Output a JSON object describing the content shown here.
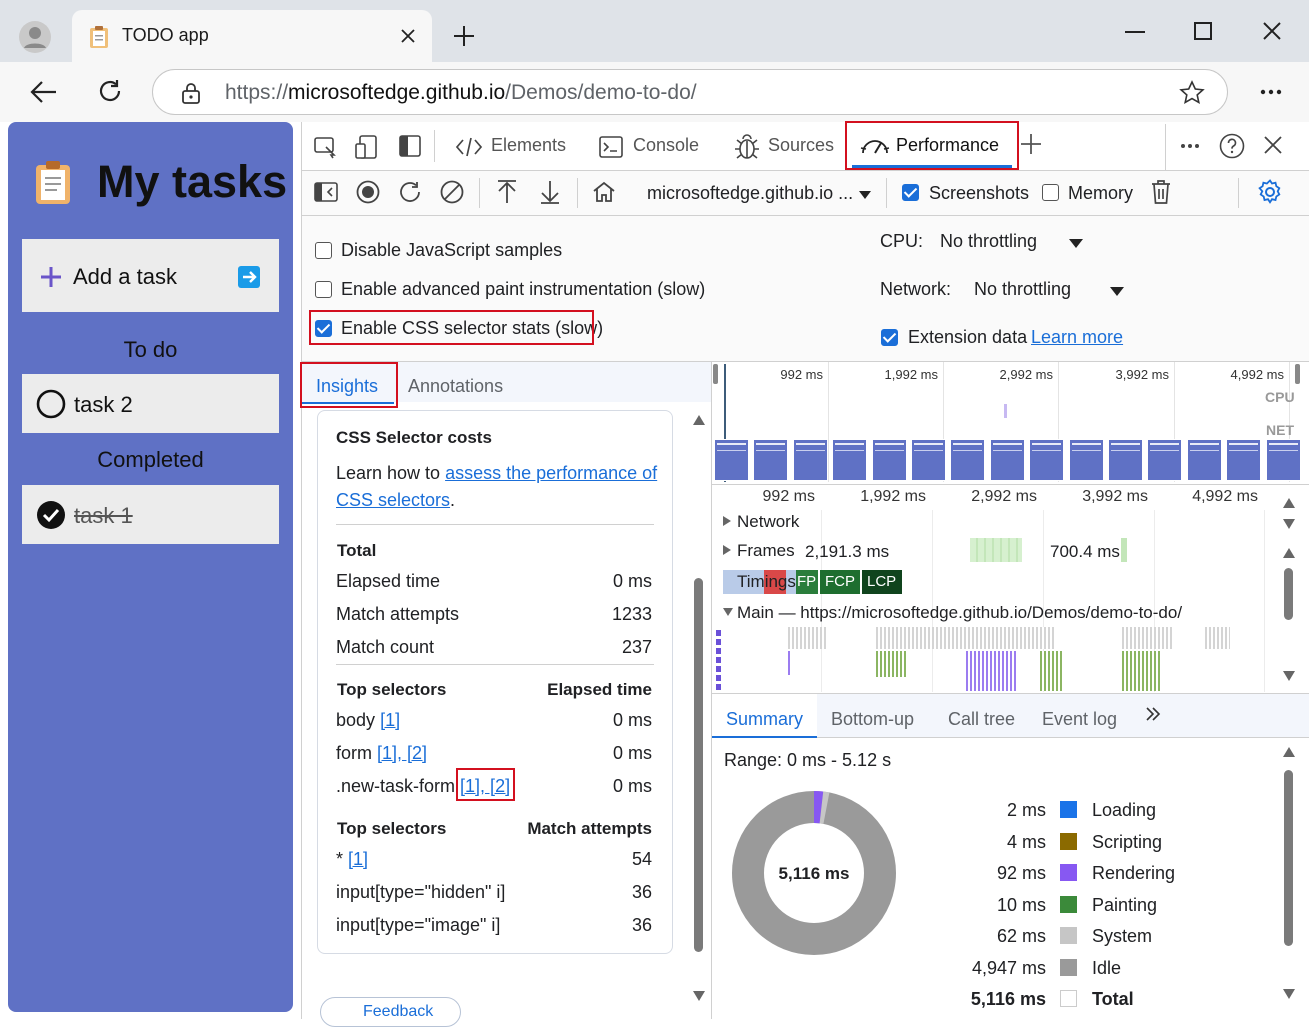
{
  "browser": {
    "tab_title": "TODO app",
    "url_scheme": "https://",
    "url_host": "microsoftedge.github.io",
    "url_path": "/Demos/demo-to-do/"
  },
  "app": {
    "title": "My tasks",
    "add_task_label": "Add a task",
    "todo_heading": "To do",
    "todo_items": [
      "task 2"
    ],
    "completed_heading": "Completed",
    "completed_items": [
      "task 1"
    ]
  },
  "devtools": {
    "tabs": [
      "Elements",
      "Console",
      "Sources",
      "Performance"
    ],
    "active_tab": "Performance",
    "target_select": "microsoftedge.github.io ...",
    "screenshots_label": "Screenshots",
    "memory_label": "Memory",
    "settings": {
      "disable_js_samples": "Disable JavaScript samples",
      "advanced_paint": "Enable advanced paint instrumentation (slow)",
      "css_selector_stats": "Enable CSS selector stats (slow)",
      "cpu_label": "CPU:",
      "cpu_value": "No throttling",
      "network_label": "Network:",
      "network_value": "No throttling",
      "extension_data": "Extension data",
      "learn_more": "Learn more"
    },
    "sidebar_tabs": [
      "Insights",
      "Annotations"
    ],
    "insight": {
      "title": "CSS Selector costs",
      "desc_prefix": "Learn how to ",
      "desc_link1": "assess the performance of",
      "desc_link2": "CSS selectors",
      "desc_suffix": ".",
      "total_heading": "Total",
      "stats": [
        {
          "label": "Elapsed time",
          "value": "0 ms"
        },
        {
          "label": "Match attempts",
          "value": "1233"
        },
        {
          "label": "Match count",
          "value": "237"
        }
      ],
      "top_selectors_heading": "Top selectors",
      "elapsed_heading": "Elapsed time",
      "elapsed_rows": [
        {
          "selector": "body",
          "refs": "[1]",
          "value": "0 ms"
        },
        {
          "selector": "form",
          "refs": "[1], [2]",
          "value": "0 ms"
        },
        {
          "selector": ".new-task-form",
          "refs": "[1], [2]",
          "value": "0 ms"
        }
      ],
      "match_heading": "Match attempts",
      "match_rows": [
        {
          "selector": "*",
          "refs": "[1]",
          "value": "54"
        },
        {
          "selector": "input[type=\"hidden\" i]",
          "refs": "",
          "value": "36"
        },
        {
          "selector": "input[type=\"image\" i]",
          "refs": "",
          "value": "36"
        }
      ],
      "feedback": "Feedback"
    },
    "overview_ticks": [
      "992 ms",
      "1,992 ms",
      "2,992 ms",
      "3,992 ms",
      "4,992 ms"
    ],
    "overview_labels": [
      "CPU",
      "NET"
    ],
    "timeline_ticks": [
      "992 ms",
      "1,992 ms",
      "2,992 ms",
      "3,992 ms",
      "4,992 ms"
    ],
    "tracks": {
      "network": "Network",
      "frames": "Frames",
      "frames_time1": "2,191.3 ms",
      "frames_time2": "700.4 ms",
      "timings": "Timings",
      "markers": [
        "FP",
        "FCP",
        "LCP"
      ],
      "main": "Main — https://microsoftedge.github.io/Demos/demo-to-do/"
    },
    "bottom_tabs": [
      "Summary",
      "Bottom-up",
      "Call tree",
      "Event log"
    ],
    "summary": {
      "range": "Range: 0 ms - 5.12 s",
      "center": "5,116 ms",
      "rows": [
        {
          "value": "2 ms",
          "label": "Loading",
          "color": "#1a73e8"
        },
        {
          "value": "4 ms",
          "label": "Scripting",
          "color": "#8b6a00"
        },
        {
          "value": "92 ms",
          "label": "Rendering",
          "color": "#8758f2"
        },
        {
          "value": "10 ms",
          "label": "Painting",
          "color": "#3b8a3a"
        },
        {
          "value": "62 ms",
          "label": "System",
          "color": "#c6c6c6"
        },
        {
          "value": "4,947 ms",
          "label": "Idle",
          "color": "#9a9a9a"
        },
        {
          "value": "5,116 ms",
          "label": "Total",
          "color": "#ffffff"
        }
      ]
    }
  }
}
